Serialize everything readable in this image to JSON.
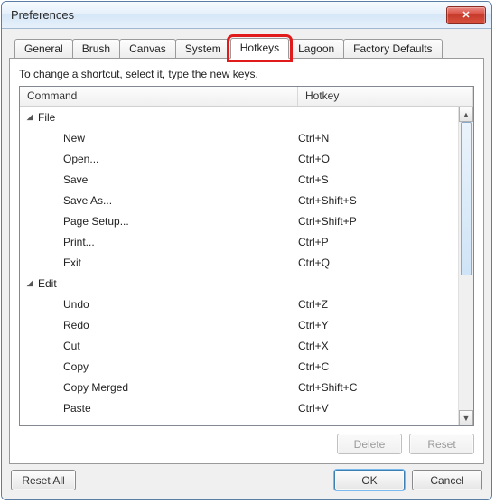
{
  "window": {
    "title": "Preferences",
    "close_label": "✕"
  },
  "tabs": [
    {
      "label": "General"
    },
    {
      "label": "Brush"
    },
    {
      "label": "Canvas"
    },
    {
      "label": "System"
    },
    {
      "label": "Hotkeys",
      "active": true,
      "highlight": true
    },
    {
      "label": "Lagoon"
    },
    {
      "label": "Factory Defaults"
    }
  ],
  "instruction": "To change a shortcut, select it, type the new keys.",
  "columns": {
    "command": "Command",
    "hotkey": "Hotkey"
  },
  "groups": [
    {
      "label": "File",
      "expanded": true,
      "items": [
        {
          "cmd": "New",
          "hk": "Ctrl+N"
        },
        {
          "cmd": "Open...",
          "hk": "Ctrl+O"
        },
        {
          "cmd": "Save",
          "hk": "Ctrl+S"
        },
        {
          "cmd": "Save As...",
          "hk": "Ctrl+Shift+S"
        },
        {
          "cmd": "Page Setup...",
          "hk": "Ctrl+Shift+P"
        },
        {
          "cmd": "Print...",
          "hk": "Ctrl+P"
        },
        {
          "cmd": "Exit",
          "hk": "Ctrl+Q"
        }
      ]
    },
    {
      "label": "Edit",
      "expanded": true,
      "items": [
        {
          "cmd": "Undo",
          "hk": "Ctrl+Z"
        },
        {
          "cmd": "Redo",
          "hk": "Ctrl+Y"
        },
        {
          "cmd": "Cut",
          "hk": "Ctrl+X"
        },
        {
          "cmd": "Copy",
          "hk": "Ctrl+C"
        },
        {
          "cmd": "Copy Merged",
          "hk": "Ctrl+Shift+C"
        },
        {
          "cmd": "Paste",
          "hk": "Ctrl+V"
        },
        {
          "cmd": "Clear",
          "hk": "Del"
        }
      ]
    }
  ],
  "buttons": {
    "delete": "Delete",
    "reset": "Reset",
    "reset_all": "Reset All",
    "ok": "OK",
    "cancel": "Cancel"
  },
  "scroll": {
    "up": "▲",
    "down": "▼"
  }
}
